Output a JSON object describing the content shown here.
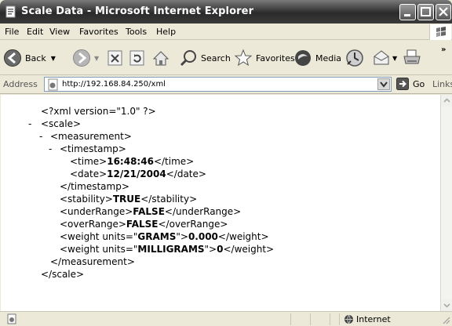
{
  "window": {
    "title": "Scale Data - Microsoft Internet Explorer"
  },
  "menu": [
    "File",
    "Edit",
    "View",
    "Favorites",
    "Tools",
    "Help"
  ],
  "toolbar": {
    "back_label": "Back",
    "search_label": "Search",
    "favorites_label": "Favorites",
    "media_label": "Media"
  },
  "address": {
    "label": "Address",
    "url": "http://192.168.84.250/xml",
    "go_label": "Go",
    "links_label": "Links"
  },
  "xml": {
    "declaration": "<?xml version=\"1.0\" ?>",
    "scale_open": "<scale>",
    "measurement_open": "<measurement>",
    "timestamp_open": "<timestamp>",
    "time_open": "<time>",
    "time_value": "16:48:46",
    "time_close": "</time>",
    "date_open": "<date>",
    "date_value": "12/21/2004",
    "date_close": "</date>",
    "timestamp_close": "</timestamp>",
    "stability_open": "<stability>",
    "stability_value": "TRUE",
    "stability_close": "</stability>",
    "underrange_open": "<underRange>",
    "underrange_value": "FALSE",
    "underrange_close": "</underRange>",
    "overrange_open": "<overRange>",
    "overrange_value": "FALSE",
    "overrange_close": "</overRange>",
    "weight1_open_a": "<weight units=\"",
    "weight1_units": "GRAMS",
    "weight1_open_b": "\">",
    "weight1_value": "0.000",
    "weight1_close": "</weight>",
    "weight2_open_a": "<weight units=\"",
    "weight2_units": "MILLIGRAMS",
    "weight2_open_b": "\">",
    "weight2_value": "0",
    "weight2_close": "</weight>",
    "measurement_close": "</measurement>",
    "scale_close": "</scale>",
    "collapse_marker": "-"
  },
  "status": {
    "zone": "Internet"
  }
}
